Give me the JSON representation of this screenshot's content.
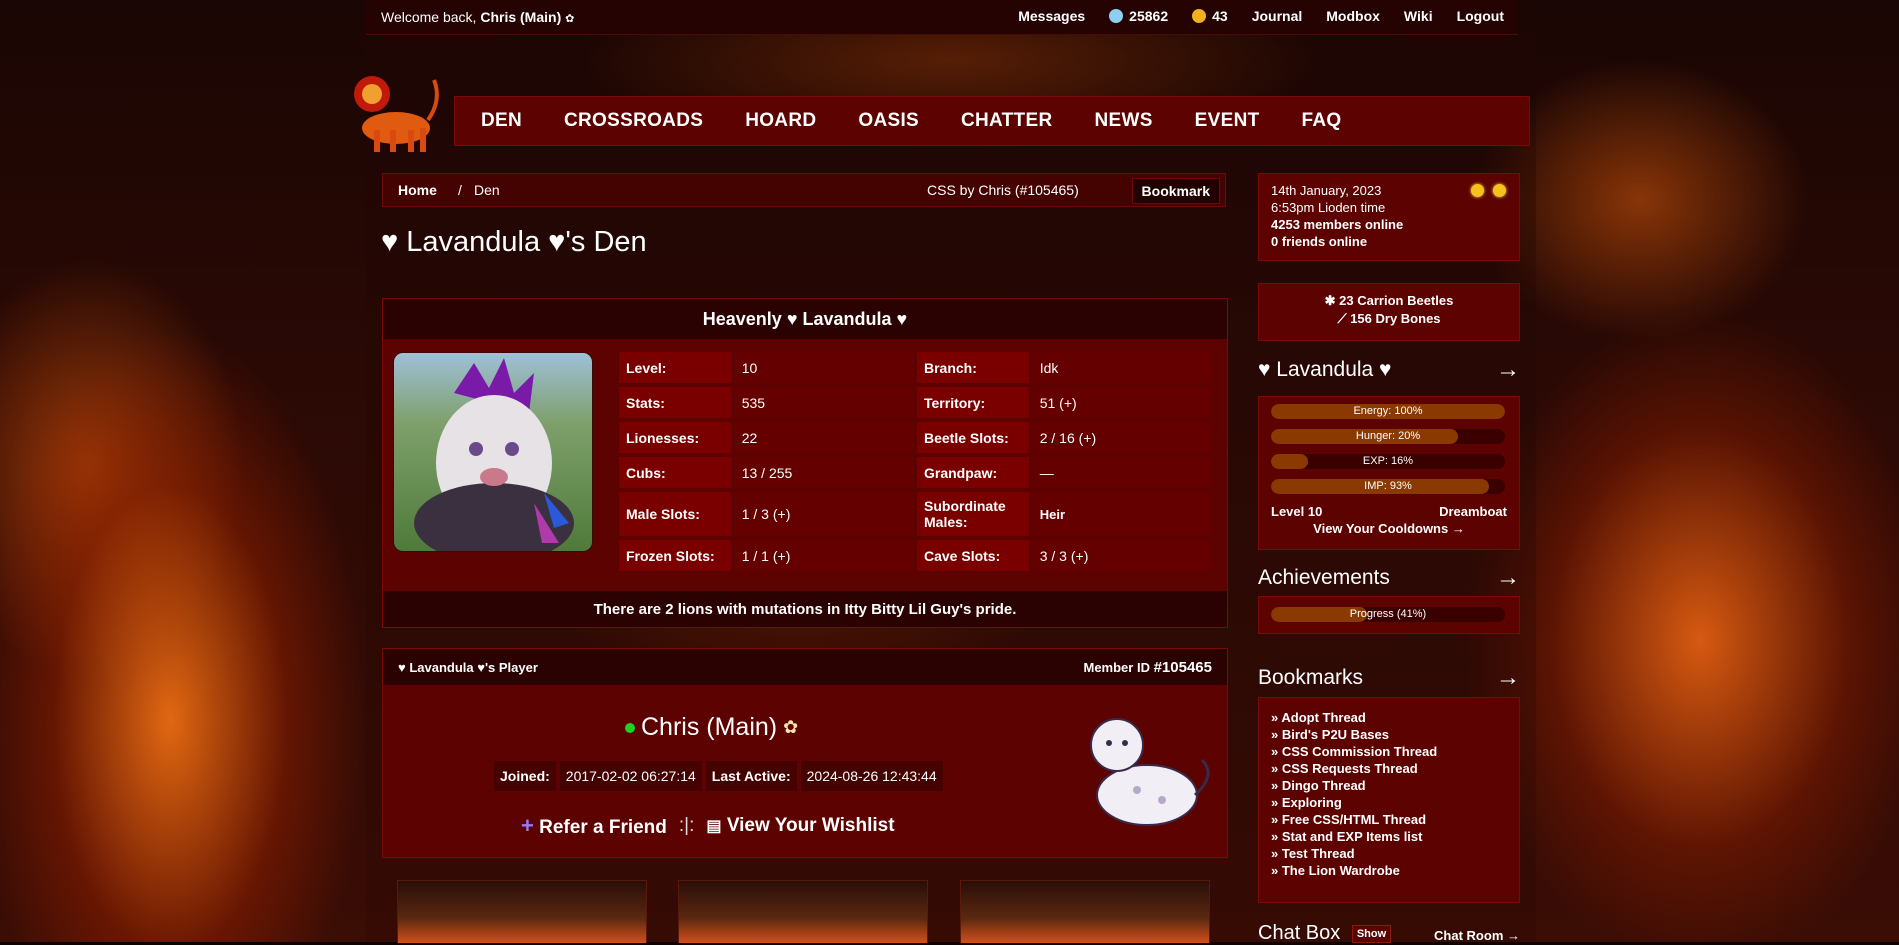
{
  "topbar": {
    "welcome_prefix": "Welcome back,",
    "username": "Chris (Main)",
    "messages": "Messages",
    "currency1": "25862",
    "currency2": "43",
    "journal": "Journal",
    "modbox": "Modbox",
    "wiki": "Wiki",
    "logout": "Logout"
  },
  "nav": [
    "DEN",
    "CROSSROADS",
    "HOARD",
    "OASIS",
    "CHATTER",
    "NEWS",
    "EVENT",
    "FAQ"
  ],
  "breadcrumb": {
    "home": "Home",
    "separator": "/",
    "current": "Den",
    "css_credit": "CSS by Chris (#105465)",
    "bookmark": "Bookmark"
  },
  "page_title": "♥ Lavandula ♥'s Den",
  "lion": {
    "name": "Heavenly ♥ Lavandula ♥",
    "stats": [
      {
        "k1": "Level:",
        "v1": "10",
        "k2": "Branch:",
        "v2": "Idk"
      },
      {
        "k1": "Stats:",
        "v1": "535",
        "k2": "Territory:",
        "v2": "51 (+)"
      },
      {
        "k1": "Lionesses:",
        "v1": "22",
        "k2": "Beetle Slots:",
        "v2": "2 / 16 (+)"
      },
      {
        "k1": "Cubs:",
        "v1": "13 / 255",
        "k2": "Grandpaw:",
        "v2": "—"
      },
      {
        "k1": "Male Slots:",
        "v1": "1 / 3 (+)",
        "k2": "Subordinate Males:",
        "v2": "Heir"
      },
      {
        "k1": "Frozen Slots:",
        "v1": "1 / 1 (+)",
        "k2": "Cave Slots:",
        "v2": "3 / 3 (+)"
      }
    ],
    "mutation_note": "There are 2 lions with mutations in Itty Bitty Lil Guy's pride."
  },
  "player": {
    "header": "♥ Lavandula ♥'s Player",
    "member_id_label": "Member ID",
    "member_id": "#105465",
    "name": "Chris (Main)",
    "joined_label": "Joined:",
    "joined": "2017-02-02 06:27:14",
    "active_label": "Last Active:",
    "active": "2024-08-26 12:43:44",
    "refer": "Refer a Friend",
    "divider": ":|:",
    "wishlist": "View Your Wishlist"
  },
  "sidebar": {
    "date": "14th January, 2023",
    "time": "6:53pm Lioden time",
    "members": "4253 members online",
    "friends": "0 friends online",
    "beetles": "23 Carrion Beetles",
    "bones": "156 Dry Bones",
    "lion_title": "♥ Lavandula ♥",
    "arrow": "→",
    "bars": [
      {
        "label": "Energy: 100%",
        "value": 100
      },
      {
        "label": "Hunger: 20%",
        "value": 80
      },
      {
        "label": "EXP: 16%",
        "value": 16
      },
      {
        "label": "IMP: 93%",
        "value": 93
      }
    ],
    "level": "Level 10",
    "rank": "Dreamboat",
    "cooldowns": "View Your Cooldowns →",
    "achievements_title": "Achievements",
    "progress_label": "Progress (41%)",
    "progress": 41,
    "bookmarks_title": "Bookmarks",
    "bookmarks": [
      "» Adopt Thread",
      "» Bird's P2U Bases",
      "» CSS Commission Thread",
      "» CSS Requests Thread",
      "» Dingo Thread",
      "» Exploring",
      "» Free CSS/HTML Thread",
      "» Stat and EXP Items list",
      "» Test Thread",
      "» The Lion Wardrobe"
    ],
    "chat_title": "Chat Box",
    "chat_show": "Show",
    "chat_room": "Chat Room →"
  }
}
